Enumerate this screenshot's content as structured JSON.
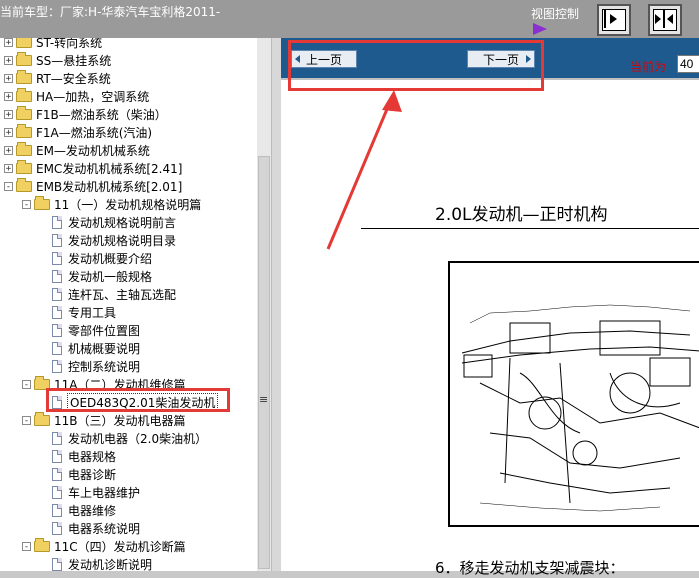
{
  "header": {
    "current_model": "当前车型：厂家:H-华泰汽车宝利格2011-",
    "view_control": "视图控制"
  },
  "nav": {
    "prev_label": "上一页",
    "next_label": "下一页",
    "current_label": "当前为",
    "current_value": "40"
  },
  "tree": {
    "items": [
      {
        "level": 0,
        "type": "folder",
        "expand": "+",
        "label": "ST-转向系统"
      },
      {
        "level": 0,
        "type": "folder",
        "expand": "+",
        "label": "SS—悬挂系统"
      },
      {
        "level": 0,
        "type": "folder",
        "expand": "+",
        "label": "RT—安全系统"
      },
      {
        "level": 0,
        "type": "folder",
        "expand": "+",
        "label": "HA—加热，空调系统"
      },
      {
        "level": 0,
        "type": "folder",
        "expand": "+",
        "label": "F1B—燃油系统（柴油）"
      },
      {
        "level": 0,
        "type": "folder",
        "expand": "+",
        "label": "F1A—燃油系统(汽油)"
      },
      {
        "level": 0,
        "type": "folder",
        "expand": "+",
        "label": "EM—发动机机械系统"
      },
      {
        "level": 0,
        "type": "folder",
        "expand": "+",
        "label": "EMC发动机机械系统[2.41]"
      },
      {
        "level": 0,
        "type": "folder",
        "expand": "-",
        "label": "EMB发动机机械系统[2.01]"
      },
      {
        "level": 1,
        "type": "folder",
        "expand": "-",
        "label": "11（一）发动机规格说明篇"
      },
      {
        "level": 2,
        "type": "page",
        "label": "发动机规格说明前言"
      },
      {
        "level": 2,
        "type": "page",
        "label": "发动机规格说明目录"
      },
      {
        "level": 2,
        "type": "page",
        "label": "发动机概要介绍"
      },
      {
        "level": 2,
        "type": "page",
        "label": "发动机一般规格"
      },
      {
        "level": 2,
        "type": "page",
        "label": "连杆瓦、主轴瓦选配"
      },
      {
        "level": 2,
        "type": "page",
        "label": "专用工具"
      },
      {
        "level": 2,
        "type": "page",
        "label": "零部件位置图"
      },
      {
        "level": 2,
        "type": "page",
        "label": "机械概要说明"
      },
      {
        "level": 2,
        "type": "page",
        "label": "控制系统说明"
      },
      {
        "level": 1,
        "type": "folder",
        "expand": "-",
        "label": "11A（二）发动机维修篇"
      },
      {
        "level": 2,
        "type": "page",
        "label": "OED483Q2.01柴油发动机",
        "selected": true
      },
      {
        "level": 1,
        "type": "folder",
        "expand": "-",
        "label": "11B（三）发动机电器篇"
      },
      {
        "level": 2,
        "type": "page",
        "label": "发动机电器（2.0柴油机）"
      },
      {
        "level": 2,
        "type": "page",
        "label": "电器规格"
      },
      {
        "level": 2,
        "type": "page",
        "label": "电器诊断"
      },
      {
        "level": 2,
        "type": "page",
        "label": "车上电器维护"
      },
      {
        "level": 2,
        "type": "page",
        "label": "电器维修"
      },
      {
        "level": 2,
        "type": "page",
        "label": "电器系统说明"
      },
      {
        "level": 1,
        "type": "folder",
        "expand": "-",
        "label": "11C（四）发动机诊断篇"
      },
      {
        "level": 2,
        "type": "page",
        "label": "发动机诊断说明"
      }
    ]
  },
  "document": {
    "title": "2.0L发动机—正时机构",
    "step": "6．移走发动机支架减震块："
  },
  "colors": {
    "nav_bar": "#1f5a8f",
    "highlight": "#e53935",
    "topbar": "#9a9a9a",
    "arrow_purple": "#8b2fd0"
  }
}
